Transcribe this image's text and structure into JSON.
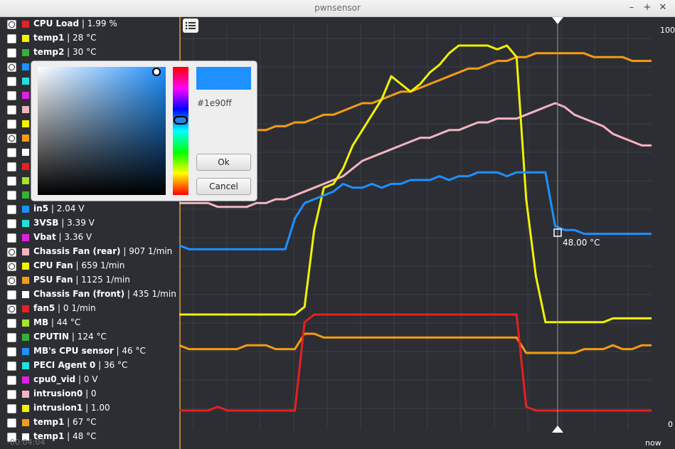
{
  "window": {
    "title": "pwnsensor",
    "buttons": [
      "–",
      "+",
      "✕"
    ]
  },
  "sensors": [
    {
      "name": "CPU Load",
      "value": "1.99 %",
      "color": "#e82020",
      "checked": true
    },
    {
      "name": "temp1",
      "value": "28 °C",
      "color": "#f2f200",
      "checked": false
    },
    {
      "name": "temp2",
      "value": "30 °C",
      "color": "#38b038",
      "checked": false
    },
    {
      "name": "",
      "value": "",
      "color": "#1e90ff",
      "checked": true
    },
    {
      "name": "",
      "value": "",
      "color": "#20e0e0",
      "checked": false
    },
    {
      "name": "",
      "value": "",
      "color": "#e020e0",
      "checked": false
    },
    {
      "name": "",
      "value": "",
      "color": "#f4b4c0",
      "checked": false
    },
    {
      "name": "",
      "value": "",
      "color": "#f2f200",
      "checked": false
    },
    {
      "name": "",
      "value": "",
      "color": "#f39c12",
      "checked": true
    },
    {
      "name": "",
      "value": "",
      "color": "#ffffff",
      "checked": false
    },
    {
      "name": "",
      "value": "",
      "color": "#e82020",
      "checked": false
    },
    {
      "name": "",
      "value": "",
      "color": "#a6e22e",
      "checked": false
    },
    {
      "name": "",
      "value": "",
      "color": "#38b038",
      "checked": false
    },
    {
      "name": "in5",
      "value": "2.04 V",
      "color": "#1e90ff",
      "checked": false
    },
    {
      "name": "3VSB",
      "value": "3.39 V",
      "color": "#20e0e0",
      "checked": false
    },
    {
      "name": "Vbat",
      "value": "3.36 V",
      "color": "#e020e0",
      "checked": false
    },
    {
      "name": "Chassis Fan (rear)",
      "value": "907 1/min",
      "color": "#f4b4c0",
      "checked": true
    },
    {
      "name": "CPU Fan",
      "value": "659 1/min",
      "color": "#f2f200",
      "checked": true
    },
    {
      "name": "PSU Fan",
      "value": "1125 1/min",
      "color": "#f39c12",
      "checked": true
    },
    {
      "name": "Chassis Fan (front)",
      "value": "435 1/min",
      "color": "#ffffff",
      "checked": false
    },
    {
      "name": "fan5",
      "value": "0 1/min",
      "color": "#e82020",
      "checked": true
    },
    {
      "name": "MB",
      "value": "44 °C",
      "color": "#a6e22e",
      "checked": false
    },
    {
      "name": "CPUTIN",
      "value": "124 °C",
      "color": "#38b038",
      "checked": false
    },
    {
      "name": "MB's CPU sensor",
      "value": "46 °C",
      "color": "#1e90ff",
      "checked": false
    },
    {
      "name": "PECI Agent 0",
      "value": "36 °C",
      "color": "#20e0e0",
      "checked": false
    },
    {
      "name": "cpu0_vid",
      "value": "0 V",
      "color": "#e020e0",
      "checked": false
    },
    {
      "name": "intrusion0",
      "value": "0",
      "color": "#f4b4c0",
      "checked": false
    },
    {
      "name": "intrusion1",
      "value": "1.00",
      "color": "#f2f200",
      "checked": false
    },
    {
      "name": "temp1",
      "value": "67 °C",
      "color": "#f39c12",
      "checked": false
    },
    {
      "name": "temp1",
      "value": "48 °C",
      "color": "#ffffff",
      "checked": false
    }
  ],
  "timeline": {
    "start_label": "-00:04:04",
    "end_label": "now",
    "y_max_label": "100",
    "y_min_label": "0"
  },
  "cursor": {
    "readout": "48.00 °C"
  },
  "color_picker": {
    "hex": "#1e90ff",
    "ok_label": "Ok",
    "cancel_label": "Cancel"
  },
  "chart_data": {
    "type": "line",
    "ylim": [
      0,
      100
    ],
    "x_range": [
      "-00:04:04",
      "now"
    ],
    "series": [
      {
        "color": "#f39c12",
        "values": [
          75,
          75,
          75,
          75,
          76,
          76,
          77,
          77,
          78,
          78,
          79,
          79,
          80,
          80,
          81,
          82,
          82,
          83,
          84,
          85,
          85,
          86,
          87,
          88,
          88,
          89,
          90,
          91,
          92,
          93,
          94,
          94,
          95,
          96,
          96,
          97,
          97,
          98,
          98,
          98,
          98,
          98,
          98,
          97,
          97,
          97,
          97,
          96,
          96,
          96
        ]
      },
      {
        "color": "#f4b4c0",
        "values": [
          59,
          59,
          59,
          59,
          58,
          58,
          58,
          58,
          59,
          59,
          60,
          60,
          61,
          62,
          63,
          64,
          65,
          66,
          68,
          70,
          71,
          72,
          73,
          74,
          75,
          76,
          76,
          77,
          78,
          78,
          79,
          80,
          80,
          81,
          81,
          81,
          82,
          83,
          84,
          85,
          84,
          82,
          81,
          80,
          79,
          77,
          76,
          75,
          74,
          74
        ]
      },
      {
        "color": "#f2f200",
        "values": [
          30,
          30,
          30,
          30,
          30,
          30,
          30,
          30,
          30,
          30,
          30,
          30,
          30,
          32,
          52,
          63,
          64,
          68,
          74,
          78,
          82,
          86,
          92,
          90,
          88,
          90,
          93,
          95,
          98,
          100,
          100,
          100,
          100,
          99,
          100,
          97,
          60,
          40,
          28,
          28,
          28,
          28,
          28,
          28,
          28,
          29,
          29,
          29,
          29,
          29
        ]
      },
      {
        "color": "#1e90ff",
        "values": [
          48,
          47,
          47,
          47,
          47,
          47,
          47,
          47,
          47,
          47,
          47,
          47,
          55,
          59,
          60,
          61,
          62,
          64,
          63,
          63,
          64,
          63,
          64,
          64,
          65,
          65,
          65,
          66,
          65,
          66,
          66,
          67,
          67,
          67,
          66,
          67,
          67,
          67,
          67,
          53,
          52,
          52,
          51,
          51,
          51,
          51,
          51,
          51,
          51,
          51
        ]
      },
      {
        "color": "#f39c12",
        "values": [
          22,
          21,
          21,
          21,
          21,
          21,
          21,
          22,
          22,
          22,
          21,
          21,
          21,
          25,
          25,
          24,
          24,
          24,
          24,
          24,
          24,
          24,
          24,
          24,
          24,
          24,
          24,
          24,
          24,
          24,
          24,
          24,
          24,
          24,
          24,
          24,
          20,
          20,
          20,
          20,
          20,
          20,
          21,
          21,
          21,
          22,
          21,
          21,
          22,
          22
        ]
      },
      {
        "color": "#e82020",
        "values": [
          5,
          5,
          5,
          5,
          6,
          5,
          5,
          5,
          5,
          5,
          5,
          5,
          5,
          28,
          30,
          30,
          30,
          30,
          30,
          30,
          30,
          30,
          30,
          30,
          30,
          30,
          30,
          30,
          30,
          30,
          30,
          30,
          30,
          30,
          30,
          30,
          6,
          5,
          5,
          5,
          5,
          5,
          5,
          5,
          5,
          5,
          5,
          5,
          5,
          5
        ]
      }
    ]
  }
}
